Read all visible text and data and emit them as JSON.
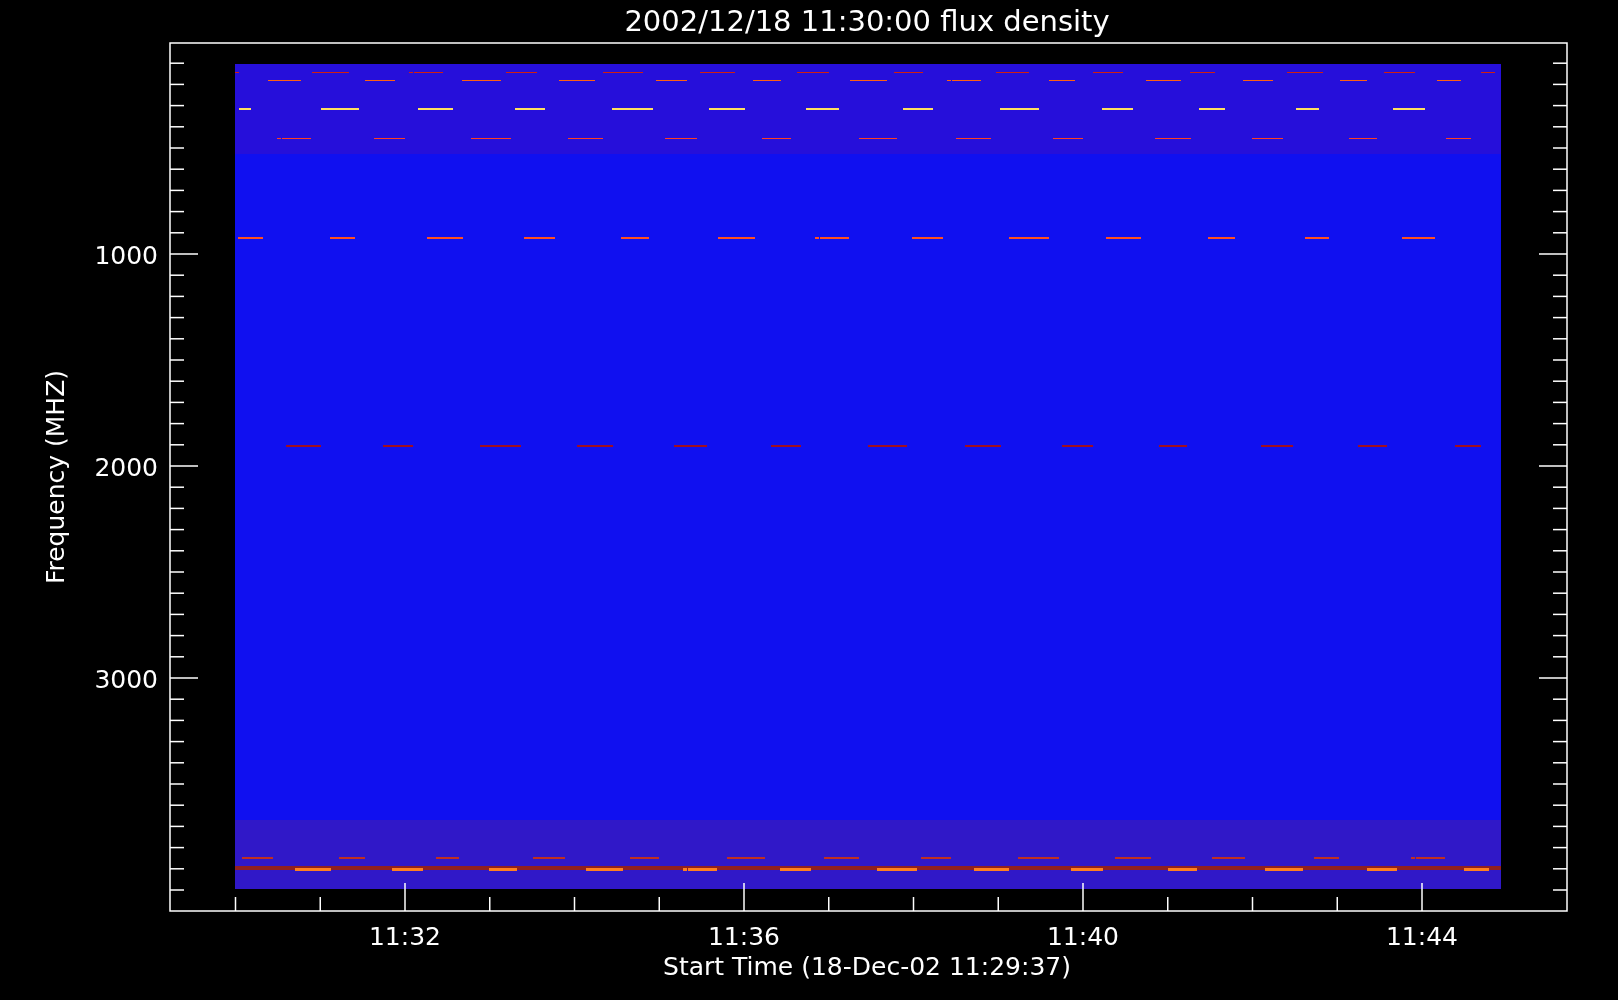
{
  "title": "2002/12/18 11:30:00 flux density",
  "y_axis": {
    "label": "Frequency (MHZ)",
    "ticks": [
      "1000",
      "2000",
      "3000"
    ]
  },
  "x_axis": {
    "label": "Start Time (18-Dec-02 11:29:37)",
    "ticks": [
      "11:32",
      "11:36",
      "11:40",
      "11:44"
    ]
  }
}
